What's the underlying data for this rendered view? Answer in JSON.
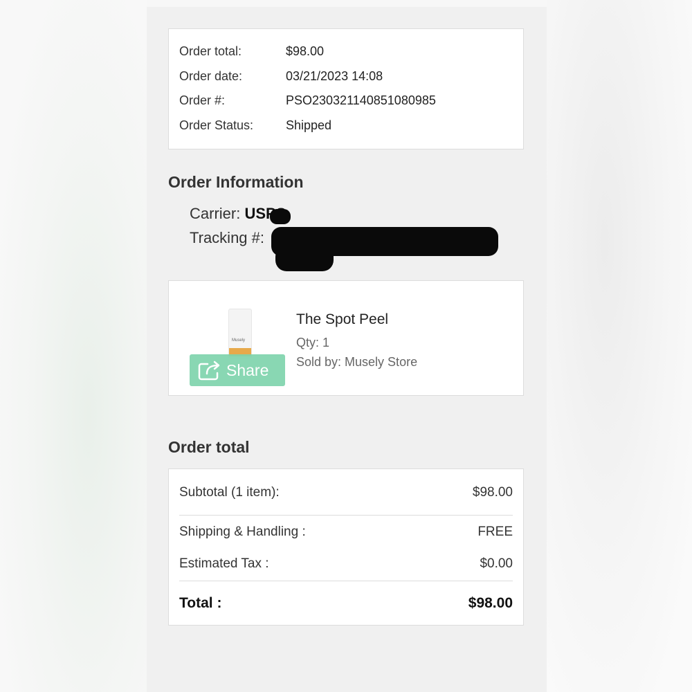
{
  "summary": {
    "rows": [
      {
        "label": "Order total:",
        "value": "$98.00"
      },
      {
        "label": "Order date:",
        "value": "03/21/2023 14:08"
      },
      {
        "label": "Order #:",
        "value": "PSO230321140851080985"
      },
      {
        "label": "Order Status:",
        "value": "Shipped"
      }
    ]
  },
  "order_info": {
    "title": "Order Information",
    "carrier_label": "Carrier:",
    "carrier_value": "USPS",
    "tracking_label": "Tracking #:"
  },
  "product": {
    "name": "The Spot Peel",
    "qty": "Qty: 1",
    "sold_by": "Sold by: Musely Store",
    "share_label": "Share",
    "thumb_label": "Musely"
  },
  "totals": {
    "title": "Order total",
    "subtotal_label": "Subtotal (1 item):",
    "subtotal_value": "$98.00",
    "shipping_label": "Shipping & Handling :",
    "shipping_value": "FREE",
    "tax_label": "Estimated Tax :",
    "tax_value": "$0.00",
    "total_label": "Total :",
    "total_value": "$98.00"
  },
  "colors": {
    "share_button": "#7fd4ad",
    "redaction": "#0a0a0a"
  }
}
